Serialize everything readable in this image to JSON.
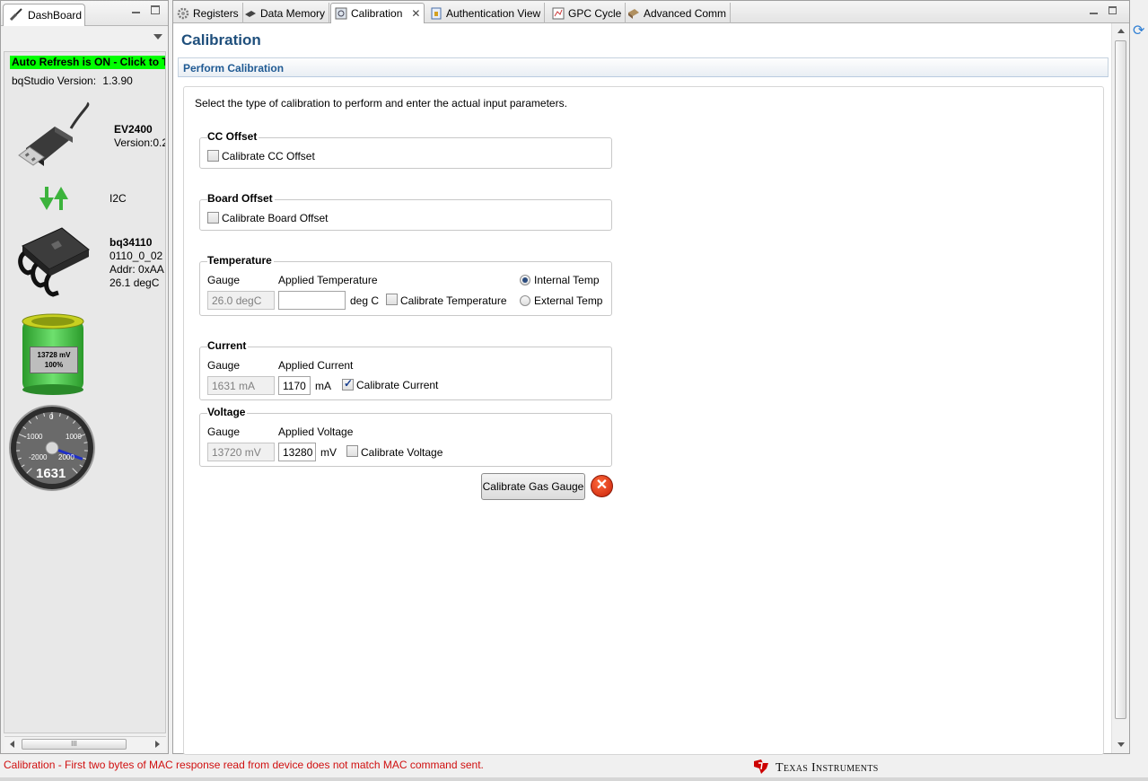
{
  "dashboard": {
    "tab_label": "DashBoard",
    "auto_refresh": "Auto Refresh is ON - Click to Tu",
    "version_label": "bqStudio Version:",
    "version_value": "1.3.90",
    "adapter_name": "EV2400",
    "adapter_version": "Version:0.2",
    "bus": "I2C",
    "device_name": "bq34110",
    "device_fw": "0110_0_02",
    "device_addr": "Addr: 0xAA",
    "device_temp": "26.1 degC",
    "battery_voltage": "13728 mV",
    "battery_percent": "100%",
    "battery_level": 1.0,
    "gauge_ticks": [
      "0",
      "-1000",
      "1000",
      "-2000",
      "2000"
    ],
    "gauge_value": "1631",
    "gauge_reading": 1631,
    "gauge_range": [
      -2000,
      2000
    ]
  },
  "tabs": [
    {
      "label": "Registers",
      "icon": "gear-icon"
    },
    {
      "label": "Data Memory",
      "icon": "chip-icon"
    },
    {
      "label": "Calibration",
      "icon": "calibration-icon",
      "active": true
    },
    {
      "label": "Authentication View",
      "icon": "auth-icon"
    },
    {
      "label": "GPC Cycle",
      "icon": "gpc-icon"
    },
    {
      "label": "Advanced Comm",
      "icon": "comm-icon"
    }
  ],
  "page": {
    "title": "Calibration",
    "section": "Perform Calibration",
    "instruction": "Select the type of calibration to perform and enter the actual input parameters."
  },
  "cc_offset": {
    "title": "CC Offset",
    "checkbox_label": "Calibrate CC Offset",
    "checked": false
  },
  "board_offset": {
    "title": "Board Offset",
    "checkbox_label": "Calibrate Board Offset",
    "checked": false
  },
  "temperature": {
    "title": "Temperature",
    "gauge_label": "Gauge",
    "gauge_value": "26.0 degC",
    "applied_label": "Applied Temperature",
    "applied_value": "",
    "unit": "deg C",
    "checkbox_label": "Calibrate Temperature",
    "checked": false,
    "radio_internal": "Internal Temp",
    "radio_external": "External Temp",
    "selected": "internal"
  },
  "current": {
    "title": "Current",
    "gauge_label": "Gauge",
    "gauge_value": "1631 mA",
    "applied_label": "Applied Current",
    "applied_value": "1170",
    "unit": "mA",
    "checkbox_label": "Calibrate Current",
    "checked": true
  },
  "voltage": {
    "title": "Voltage",
    "gauge_label": "Gauge",
    "gauge_value": "13720 mV",
    "applied_label": "Applied Voltage",
    "applied_value": "13280",
    "unit": "mV",
    "checkbox_label": "Calibrate Voltage",
    "checked": false
  },
  "actions": {
    "calibrate_button": "Calibrate Gas Gauge",
    "cancel_icon": "cancel-icon"
  },
  "status": {
    "message": "Calibration - First two bytes of MAC response read from device does not match MAC command sent.",
    "logo_text": "Texas Instruments"
  },
  "colors": {
    "auto_refresh_bg": "#00ff00",
    "title_blue": "#1f4f7c",
    "status_error": "#d01010"
  }
}
